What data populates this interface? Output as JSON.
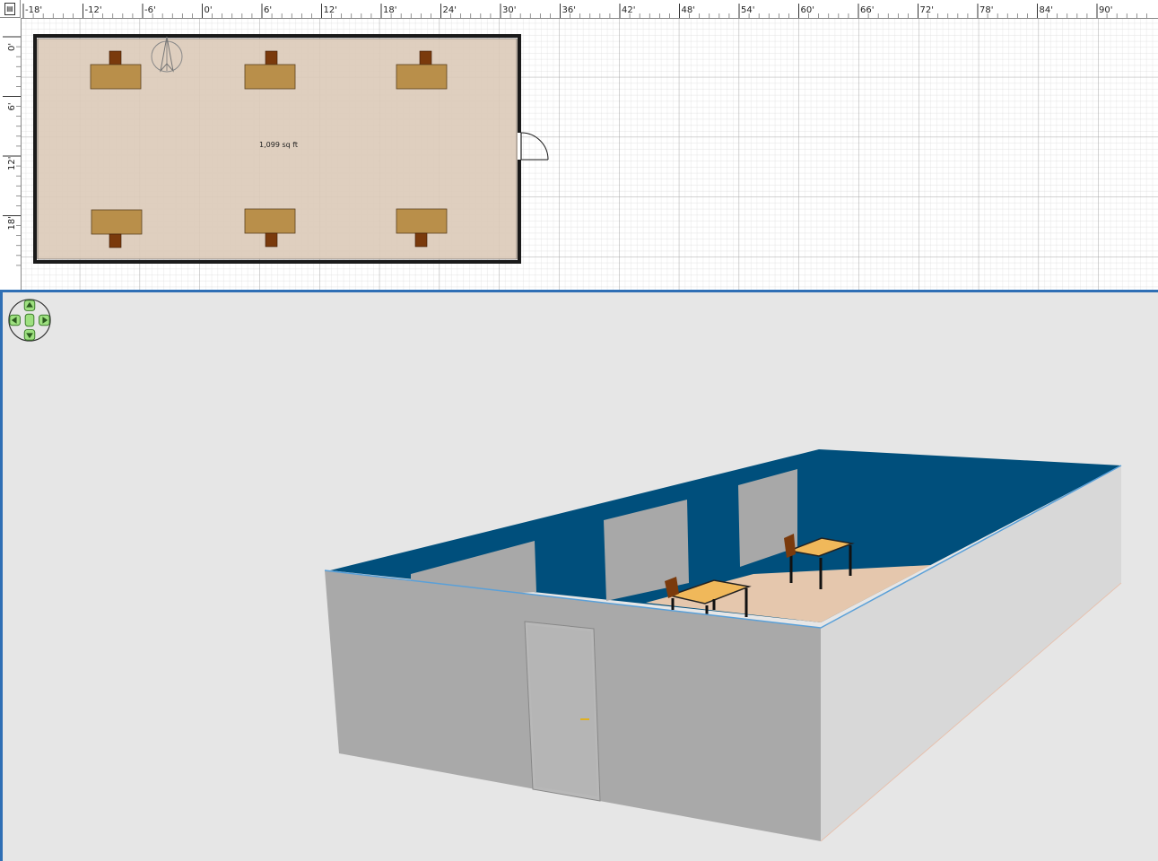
{
  "plan": {
    "area_label": "1,099 sq ft",
    "horizontal_ruler_labels": [
      "-18'",
      "-12'",
      "-6'",
      "0'",
      "6'",
      "12'",
      "18'",
      "24'",
      "30'",
      "36'",
      "42'",
      "48'",
      "54'",
      "60'",
      "66'",
      "72'",
      "78'",
      "84'",
      "90'"
    ],
    "vertical_ruler_labels": [
      "0'",
      "6'",
      "12'",
      "18'"
    ],
    "colors": {
      "floor": "#dccab8",
      "table": "#b98f4a",
      "chair": "#7a3a0c",
      "wall": "#1a1a1a"
    }
  },
  "view3d": {
    "navigation_icon": "arrows-navigation-icon",
    "colors": {
      "background": "#e6e6e6",
      "wall_outer": "#a9a9a9",
      "wall_right": "#d8d8d8",
      "wall_inner": "#004f7c",
      "floor": "#e5c7ad",
      "table_top": "#f0b85a",
      "door": "#b8b8b8"
    }
  }
}
